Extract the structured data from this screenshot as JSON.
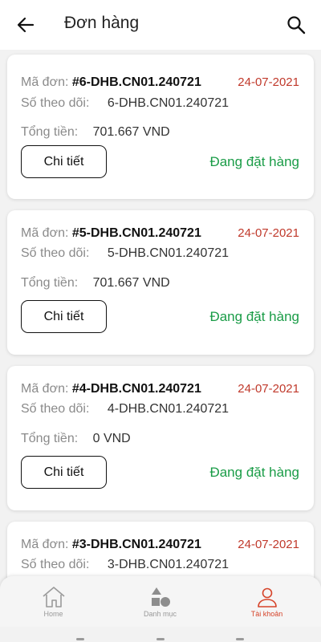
{
  "appbar": {
    "title": "Đơn hàng",
    "back_icon": "arrow-left-icon",
    "search_icon": "search-icon"
  },
  "labels": {
    "order_code": "Mã đơn:",
    "tracking": "Số theo dõi:",
    "total": "Tổng tiền:",
    "detail_button": "Chi tiết"
  },
  "orders": [
    {
      "code": "#6-DHB.CN01.240721",
      "date": "24-07-2021",
      "tracking": "6-DHB.CN01.240721",
      "total": "701.667 VND",
      "status": "Đang đặt hàng"
    },
    {
      "code": "#5-DHB.CN01.240721",
      "date": "24-07-2021",
      "tracking": "5-DHB.CN01.240721",
      "total": "701.667 VND",
      "status": "Đang đặt hàng"
    },
    {
      "code": "#4-DHB.CN01.240721",
      "date": "24-07-2021",
      "tracking": "4-DHB.CN01.240721",
      "total": "0 VND",
      "status": "Đang đặt hàng"
    },
    {
      "code": "#3-DHB.CN01.240721",
      "date": "24-07-2021",
      "tracking": "3-DHB.CN01.240721",
      "total": "",
      "status": ""
    }
  ],
  "bottom_nav": [
    {
      "label": "Home",
      "icon": "home-icon",
      "active": false
    },
    {
      "label": "Danh mục",
      "icon": "category-shapes-icon",
      "active": false
    },
    {
      "label": "Tài khoản",
      "icon": "user-icon",
      "active": true
    }
  ],
  "colors": {
    "date": "#c0392b",
    "status": "#1a9c47",
    "active_nav": "#d6452b"
  }
}
